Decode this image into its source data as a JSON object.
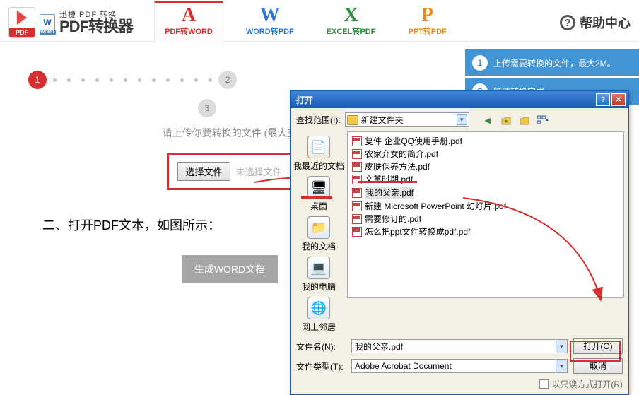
{
  "brand": {
    "sub": "迅捷 PDF 转换",
    "main": "PDF转换器"
  },
  "tabs": {
    "pdf2word": "PDF转WORD",
    "word2pdf": "WORD转PDF",
    "excel2pdf": "EXCEL转PDF",
    "ppt2pdf": "PPT转PDF"
  },
  "help": {
    "label": "帮助中心",
    "icon": "?"
  },
  "right_tip": {
    "s1_num": "1",
    "s1": "上传需要转换的文件，最大2M。",
    "s2_num": "2",
    "s2": "等待转换完成"
  },
  "steps": {
    "one": "1",
    "two": "2",
    "three": "3"
  },
  "upload": {
    "hint": "请上传你要转换的文件 (最大支",
    "choose": "选择文件",
    "none": "未选择文件",
    "generate": "生成WORD文档"
  },
  "annotation": "二、打开PDF文本，如图所示：",
  "dialog": {
    "title": "打开",
    "look_label": "查找范围(I):",
    "folder_name": "新建文件夹",
    "sidebar": {
      "recent": "我最近的文档",
      "desktop": "桌面",
      "mydocs": "我的文档",
      "mypc": "我的电脑",
      "network": "网上邻居"
    },
    "files": [
      "复件 企业QQ使用手册.pdf",
      "农家弃女的简介.pdf",
      "皮肤保养方法.pdf",
      "文革时期.pdf",
      "我的父亲.pdf",
      "新建 Microsoft PowerPoint 幻灯片.pdf",
      "需要修订的.pdf",
      "怎么把ppt文件转换成pdf.pdf"
    ],
    "selected_index": 4,
    "filename_label": "文件名(N):",
    "filetype_label": "文件类型(T):",
    "filename_value": "我的父亲.pdf",
    "filetype_value": "Adobe Acrobat Document",
    "open_btn": "打开(O)",
    "cancel_btn": "取消",
    "readonly": "以只读方式打开(R)"
  }
}
